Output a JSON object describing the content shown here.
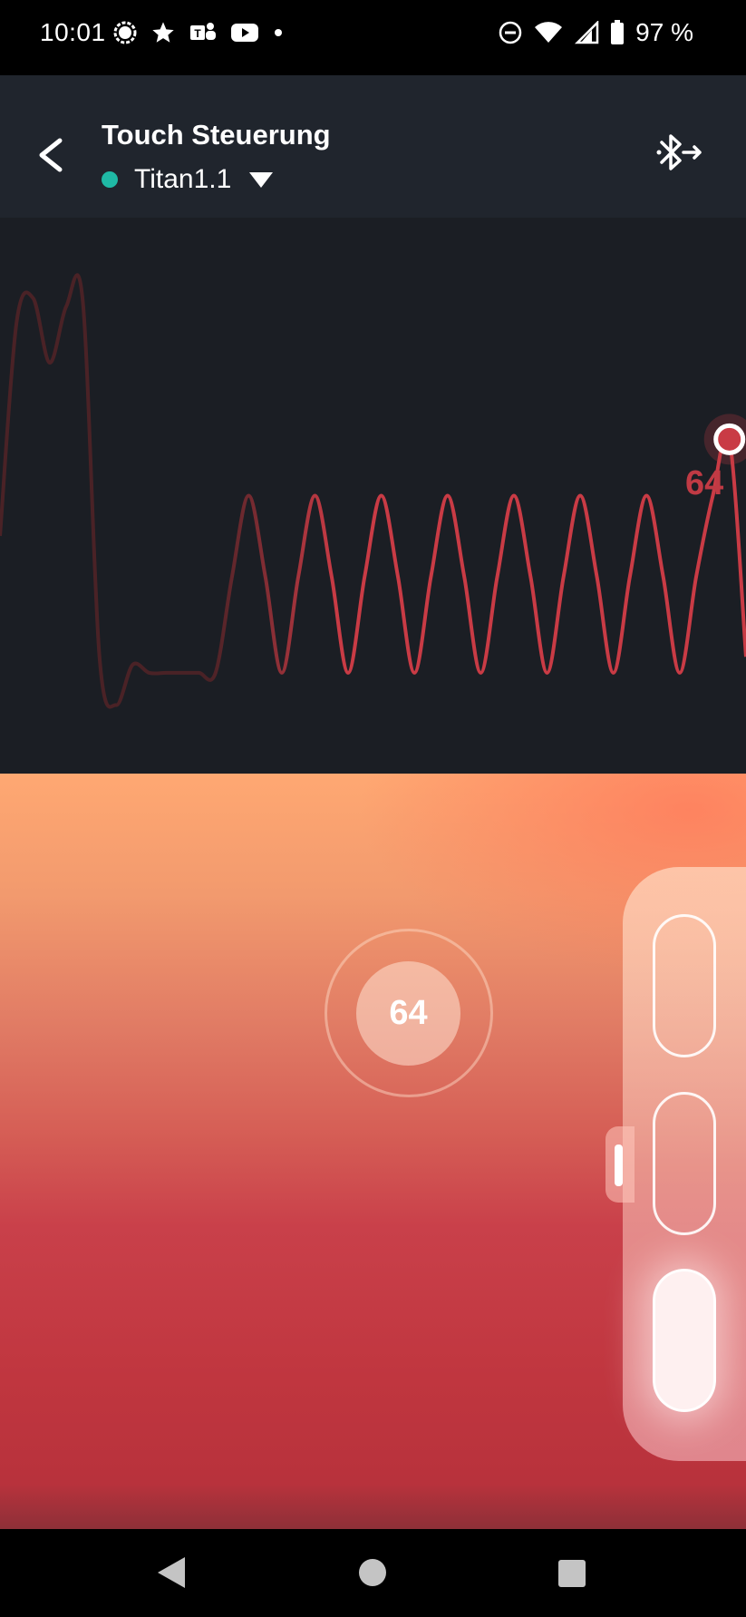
{
  "status_bar": {
    "time": "10:01",
    "battery_percent": "97 %",
    "left_icons": [
      "signal-messenger-icon",
      "star-icon",
      "teams-icon",
      "youtube-icon",
      "dot-icon"
    ],
    "right_icons": [
      "do-not-disturb-icon",
      "wifi-icon",
      "cell-signal-icon",
      "battery-icon"
    ]
  },
  "header": {
    "title": "Touch Steuerung",
    "device": {
      "name": "Titan1.1",
      "status_color": "#1fb9a5"
    },
    "icons": {
      "back": "back-arrow-icon",
      "bluetooth": "bluetooth-connect-icon",
      "dropdown": "dropdown-triangle-icon"
    }
  },
  "chart_data": {
    "type": "line",
    "title": "",
    "xlabel": "",
    "ylabel": "",
    "current_value_label": "64",
    "x": [
      0,
      4,
      8,
      12,
      16,
      20,
      24,
      28,
      32,
      36,
      40,
      44,
      48,
      52,
      56,
      60,
      64,
      68,
      72,
      76,
      80,
      84,
      88,
      92,
      96,
      100,
      104,
      108,
      112,
      116,
      120,
      124,
      128,
      132,
      136,
      140,
      144,
      148,
      152,
      156,
      160,
      164,
      168,
      172,
      176,
      180
    ],
    "values": [
      40,
      93,
      99,
      83,
      97,
      98,
      10,
      -2,
      8,
      6,
      6,
      6,
      6,
      6,
      30,
      50,
      30,
      6,
      30,
      50,
      30,
      6,
      30,
      50,
      30,
      6,
      30,
      50,
      30,
      6,
      30,
      50,
      30,
      6,
      30,
      50,
      30,
      6,
      30,
      50,
      30,
      6,
      30,
      50,
      64,
      10
    ],
    "ylim": [
      -10,
      110
    ],
    "line_color": "#c93b45",
    "faded_color": "#4a2226"
  },
  "touch_control": {
    "knob_value": "64"
  },
  "side_panel": {
    "presets": [
      {
        "name": "preset-1",
        "active": false
      },
      {
        "name": "preset-2",
        "active": false
      },
      {
        "name": "preset-3",
        "active": true
      }
    ]
  },
  "nav_bar": {
    "icons": [
      "nav-back-icon",
      "nav-home-icon",
      "nav-recents-icon"
    ]
  }
}
